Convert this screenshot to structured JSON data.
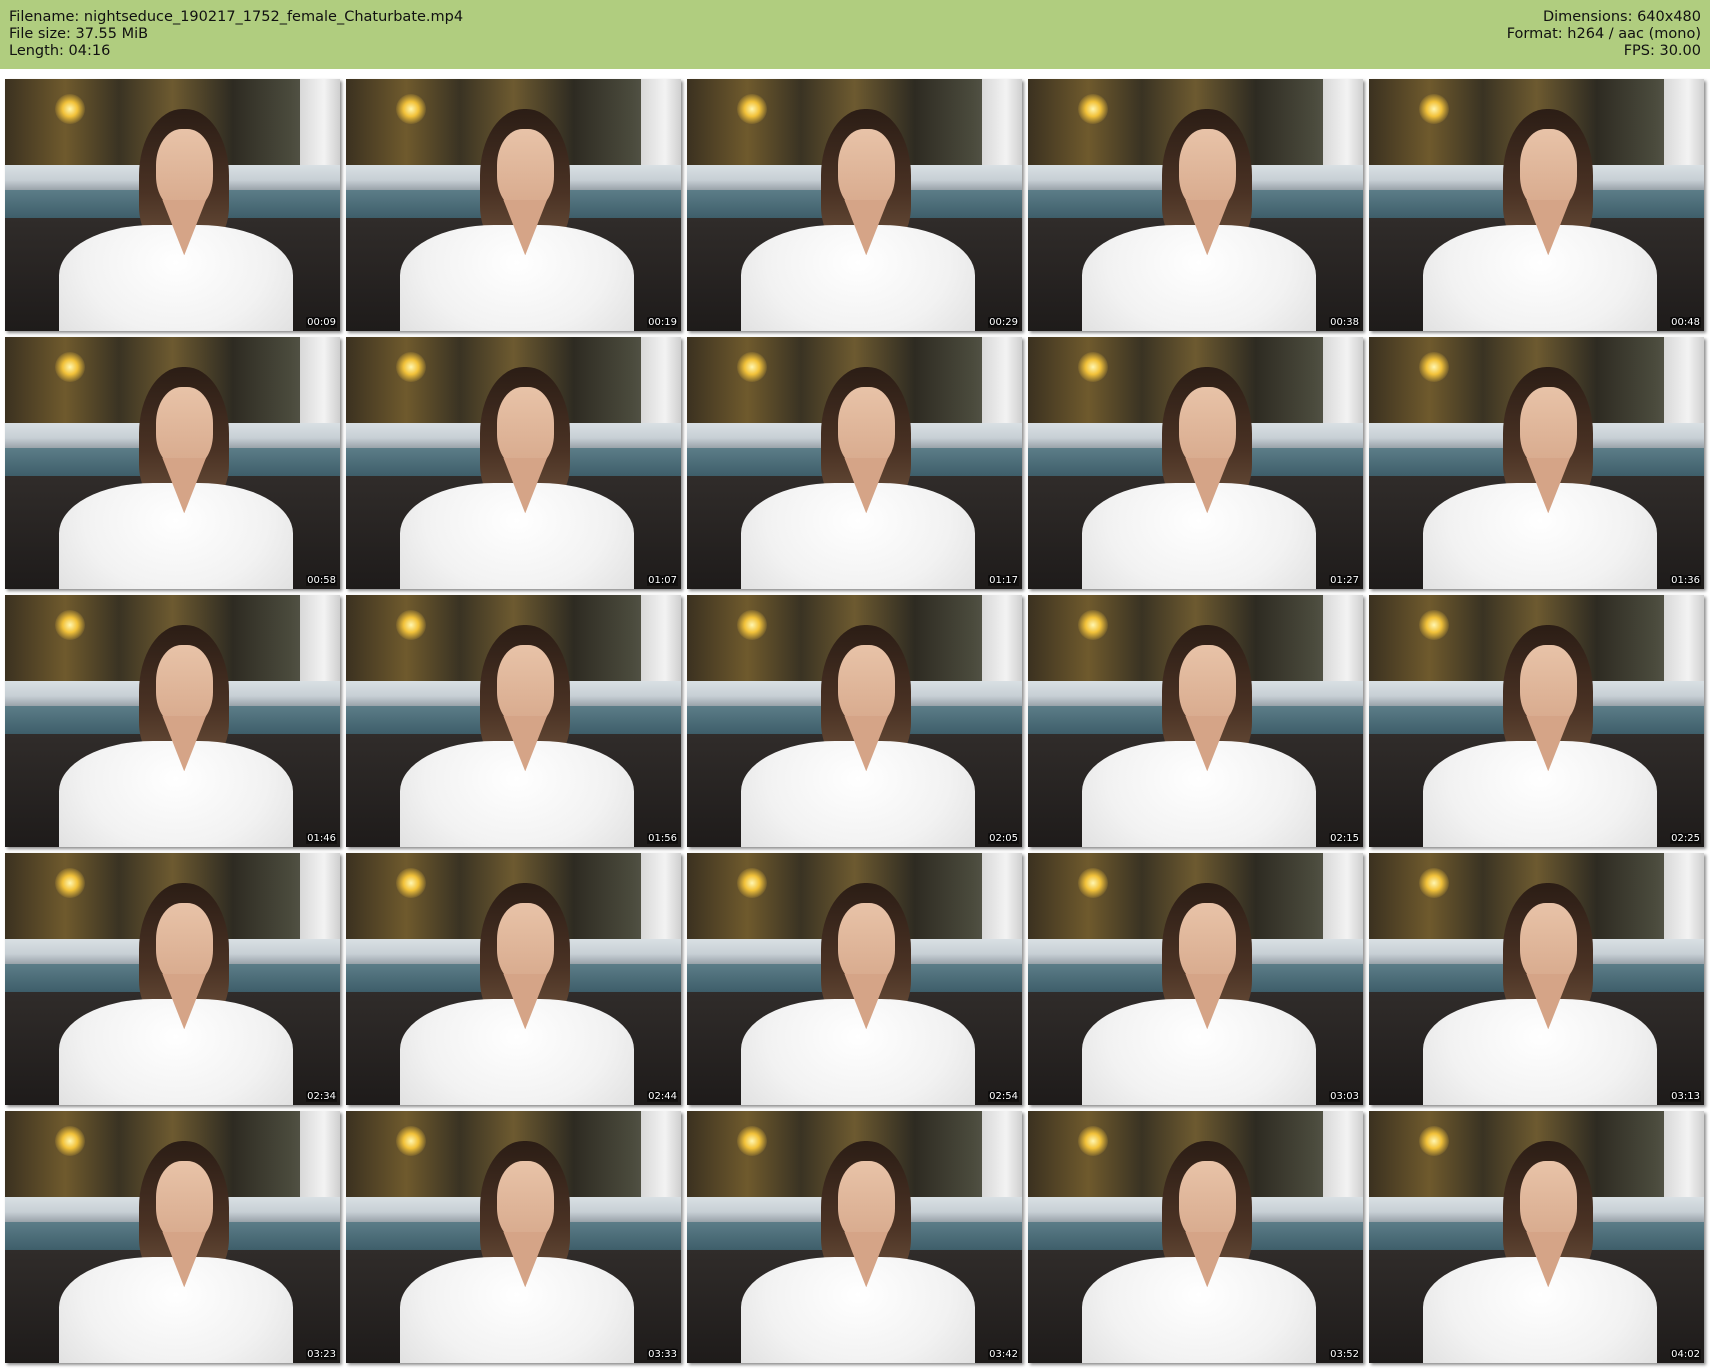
{
  "header": {
    "filename_label": "Filename:",
    "filename": "nightseduce_190217_1752_female_Chaturbate.mp4",
    "filesize_label": "File size:",
    "filesize": "37.55 MiB",
    "length_label": "Length:",
    "length": "04:16",
    "dimensions_label": "Dimensions:",
    "dimensions": "640x480",
    "format_label": "Format:",
    "format": "h264 / aac (mono)",
    "fps_label": "FPS:",
    "fps": "30.00"
  },
  "thumbnails": [
    {
      "timestamp": "00:09"
    },
    {
      "timestamp": "00:19"
    },
    {
      "timestamp": "00:29"
    },
    {
      "timestamp": "00:38"
    },
    {
      "timestamp": "00:48"
    },
    {
      "timestamp": "00:58"
    },
    {
      "timestamp": "01:07"
    },
    {
      "timestamp": "01:17"
    },
    {
      "timestamp": "01:27"
    },
    {
      "timestamp": "01:36"
    },
    {
      "timestamp": "01:46"
    },
    {
      "timestamp": "01:56"
    },
    {
      "timestamp": "02:05"
    },
    {
      "timestamp": "02:15"
    },
    {
      "timestamp": "02:25"
    },
    {
      "timestamp": "02:34"
    },
    {
      "timestamp": "02:44"
    },
    {
      "timestamp": "02:54"
    },
    {
      "timestamp": "03:03"
    },
    {
      "timestamp": "03:13"
    },
    {
      "timestamp": "03:23"
    },
    {
      "timestamp": "03:33"
    },
    {
      "timestamp": "03:42"
    },
    {
      "timestamp": "03:52"
    },
    {
      "timestamp": "04:02"
    }
  ],
  "colors": {
    "header_background": "#b0cd7f",
    "page_background": "#ffffff"
  }
}
